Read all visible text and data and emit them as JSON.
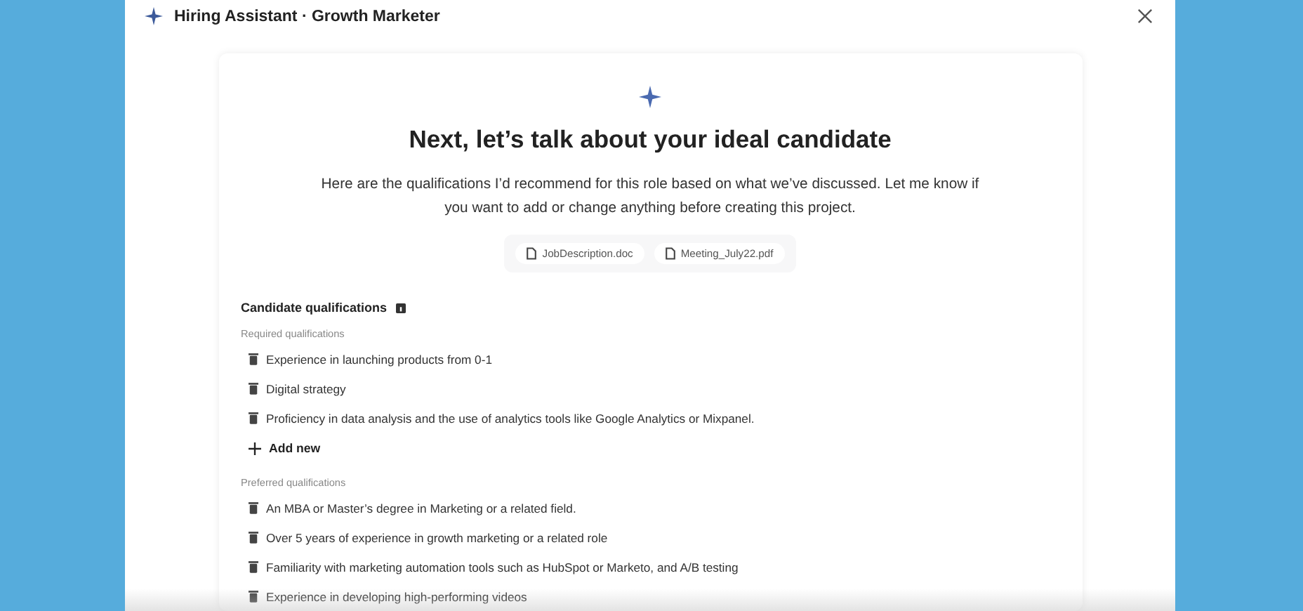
{
  "window": {
    "title": "Hiring Assistant · Growth Marketer"
  },
  "heading": "Next, let’s talk about your ideal candidate",
  "intro": "Here are the qualifications I’d recommend for this role based on what we’ve discussed. Let me know if you want to add or change anything before creating this project.",
  "attachments": [
    "JobDescription.doc",
    "Meeting_July22.pdf"
  ],
  "qualifications": {
    "title": "Candidate qualifications",
    "groups": [
      {
        "label": "Required qualifications",
        "items": [
          "Experience in launching products from 0-1",
          "Digital strategy",
          "Proficiency in data analysis and the use of analytics tools like Google Analytics or Mixpanel."
        ],
        "add_label": "Add new"
      },
      {
        "label": "Preferred qualifications",
        "items": [
          "An MBA or Master’s degree in Marketing or a related field.",
          "Over 5 years of experience in growth marketing or a related role",
          "Familiarity with marketing automation tools such as HubSpot or Marketo, and A/B testing",
          "Experience in developing high-performing videos"
        ]
      }
    ]
  }
}
